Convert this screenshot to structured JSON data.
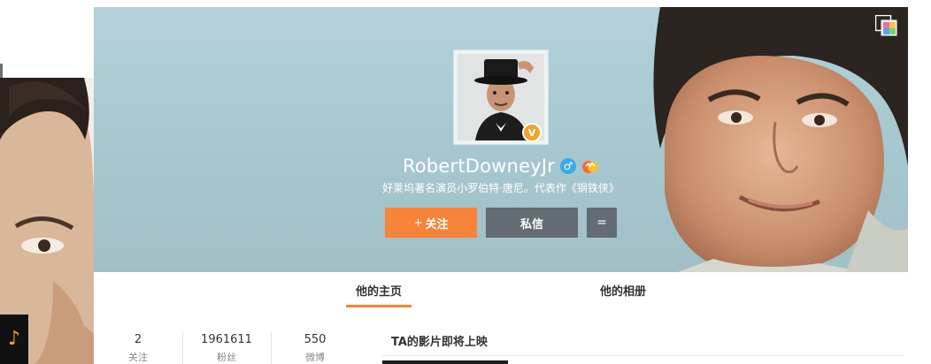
{
  "profile": {
    "username": "RobertDowneyJr",
    "bio": "好莱坞著名演员小罗伯特·唐尼。代表作《钢铁侠》",
    "verified_badge": "V",
    "gender_icon": "♂"
  },
  "actions": {
    "follow_plus": "+",
    "follow_label": "关注",
    "message_label": "私信",
    "more_label": "="
  },
  "tabs": [
    {
      "label": "他的主页",
      "active": true
    },
    {
      "label": "他的相册",
      "active": false
    }
  ],
  "stats": [
    {
      "value": "2",
      "label": "关注"
    },
    {
      "value": "1961611",
      "label": "粉丝"
    },
    {
      "value": "550",
      "label": "微博"
    }
  ],
  "films": {
    "title": "TA的影片即将上映"
  },
  "music": {
    "icon": "♪"
  },
  "colors": {
    "accent": "#f6833a",
    "button_dark": "#636b73",
    "verified": "#f2a32e",
    "gender": "#3ea8ea",
    "cover_bg": "#a6c7cf"
  }
}
